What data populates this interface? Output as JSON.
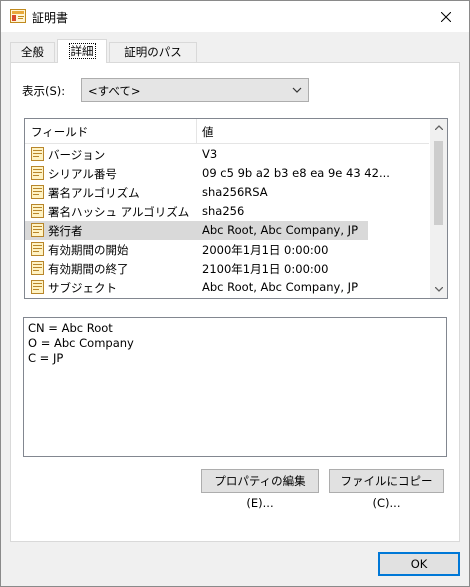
{
  "window": {
    "title": "証明書"
  },
  "tabs": [
    {
      "label": "全般",
      "active": false
    },
    {
      "label": "詳細",
      "active": true
    },
    {
      "label": "証明のパス",
      "active": false
    }
  ],
  "show": {
    "label": "表示(S):",
    "value": "<すべて>"
  },
  "list": {
    "columns": {
      "field": "フィールド",
      "value": "値"
    },
    "rows": [
      {
        "field": "バージョン",
        "value": "V3",
        "icon": "certificate-field-icon"
      },
      {
        "field": "シリアル番号",
        "value": "09 c5 9b a2 b3 e8 ea 9e 43 42...",
        "icon": "certificate-field-icon"
      },
      {
        "field": "署名アルゴリズム",
        "value": "sha256RSA",
        "icon": "certificate-field-icon"
      },
      {
        "field": "署名ハッシュ アルゴリズム",
        "value": "sha256",
        "icon": "certificate-field-icon"
      },
      {
        "field": "発行者",
        "value": "Abc Root, Abc Company, JP",
        "icon": "certificate-field-icon",
        "selected": true
      },
      {
        "field": "有効期間の開始",
        "value": "2000年1月1日 0:00:00",
        "icon": "certificate-field-icon"
      },
      {
        "field": "有効期間の終了",
        "value": "2100年1月1日 0:00:00",
        "icon": "certificate-field-icon"
      },
      {
        "field": "サブジェクト",
        "value": "Abc Root, Abc Company, JP",
        "icon": "certificate-field-icon"
      }
    ]
  },
  "detail": {
    "lines": [
      "CN = Abc Root",
      "O = Abc Company",
      "C = JP"
    ]
  },
  "buttons": {
    "edit_properties": "プロパティの編集(E)...",
    "copy_to_file": "ファイルにコピー(C)...",
    "ok": "OK"
  },
  "colors": {
    "selection": "#d9d9d9",
    "ok_border": "#0078d7",
    "titlebar": "#ffffff"
  }
}
